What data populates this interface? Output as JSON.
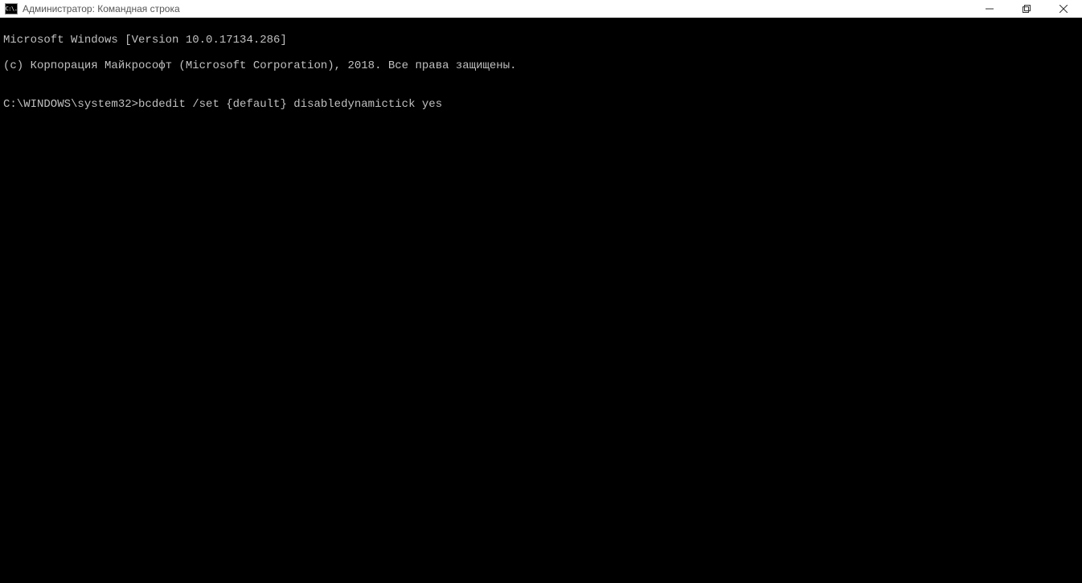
{
  "titlebar": {
    "icon_label": "C:\\.",
    "title": "Администратор: Командная строка"
  },
  "terminal": {
    "line1": "Microsoft Windows [Version 10.0.17134.286]",
    "line2": "(c) Корпорация Майкрософт (Microsoft Corporation), 2018. Все права защищены.",
    "blank": "",
    "prompt": "C:\\WINDOWS\\system32>",
    "command": "bcdedit /set {default} disabledynamictick yes"
  }
}
